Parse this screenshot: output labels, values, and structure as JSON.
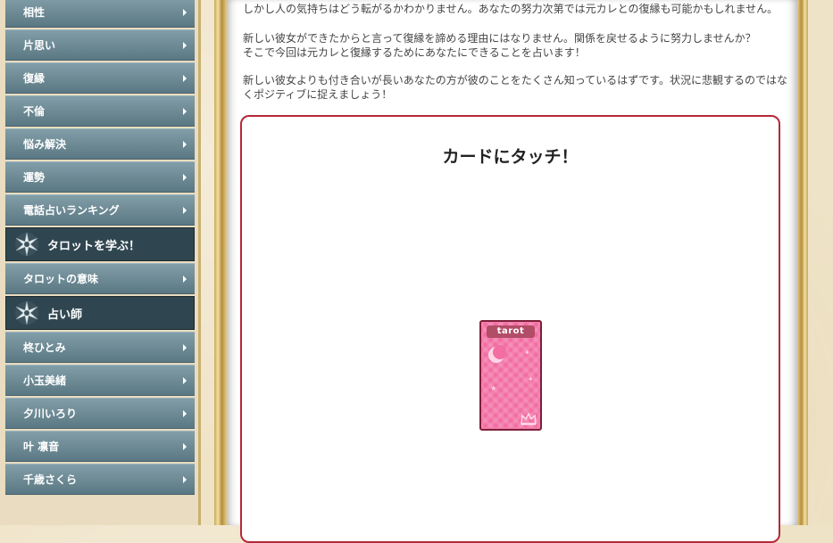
{
  "sidebar": {
    "items": [
      {
        "label": "相性"
      },
      {
        "label": "片思い"
      },
      {
        "label": "復縁"
      },
      {
        "label": "不倫"
      },
      {
        "label": "悩み解決"
      },
      {
        "label": "運勢"
      },
      {
        "label": "電話占いランキング"
      }
    ],
    "section_learn": {
      "label": "タロットを学ぶ！"
    },
    "learn_items": [
      {
        "label": "タロットの意味"
      }
    ],
    "section_readers": {
      "label": "占い師"
    },
    "reader_items": [
      {
        "label": "柊ひとみ"
      },
      {
        "label": "小玉美緒"
      },
      {
        "label": "夕川いろり"
      },
      {
        "label": "叶 凛音"
      },
      {
        "label": "千歳さくら"
      }
    ]
  },
  "main": {
    "paragraphs": [
      "しかし人の気持ちはどう転がるかわかりません。あなたの努力次第では元カレとの復縁も可能かもしれません。",
      "新しい彼女ができたからと言って復縁を諦める理由にはなりません。関係を戻せるように努力しませんか？\nそこで今回は元カレと復縁するためにあなたにできることを占います！",
      "新しい彼女よりも付き合いが長いあなたの方が彼のことをたくさん知っているはずです。状況に悲観するのではなくポジティブに捉えましょう！"
    ],
    "card_section": {
      "title": "カードにタッチ！",
      "card_label": "tarot"
    }
  }
}
